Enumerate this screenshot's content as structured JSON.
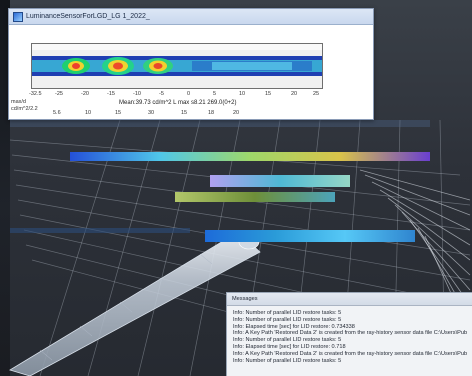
{
  "luminance_window": {
    "title": "LuminanceSensorForLGD_LG 1_2022_",
    "x_ticks": [
      "-32.5",
      "-25",
      "-20",
      "-15",
      "-10",
      "-5",
      "0",
      "5",
      "10",
      "15",
      "20",
      "25"
    ],
    "readout_x": "max/d",
    "readout_unit": "cd/m^2/2.2",
    "stats": "Mean:39.73 cd/m^2 L max s8.21 269.0(0+2)",
    "scale_ticks": [
      "5.6",
      "10",
      "15",
      "30",
      "15",
      "18",
      "20"
    ],
    "colors": {
      "accent": "#2c6bd6",
      "plot_border": "#6f6f6f"
    }
  },
  "messages_panel": {
    "title": "Messages",
    "lines": [
      "Info: Number of parallel LID restore tasks: 5",
      "Info: Number of parallel LID restore tasks: 5",
      "Info: Elapsed time [sec] for LID restore: 0.734338",
      "Info: A Key Path 'Restored Data 2' is created from the ray-history sensor data file C:\\Users\\Public\\Documents\\LucidShape",
      "Info: Number of parallel LID restore tasks: 5",
      "Info: Elapsed time [sec] for LID restore: 0.718",
      "Info: A Key Path 'Restored Data 2' is created from the ray-history sensor data file C:\\Users\\Public\\Documents\\Lu",
      "Info: Number of parallel LID restore tasks: 5"
    ]
  },
  "scene": {
    "background": "#2b2f36",
    "mesh_color": "#d6dde8"
  }
}
